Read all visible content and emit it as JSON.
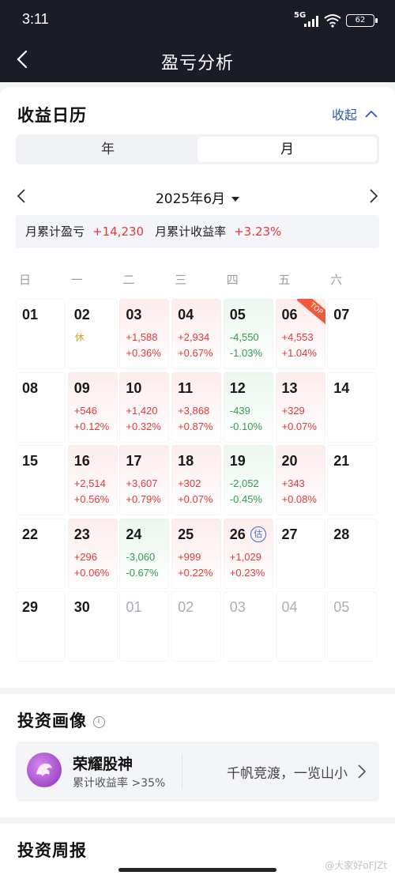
{
  "status": {
    "time": "3:11",
    "network": "5G",
    "battery": "62"
  },
  "nav": {
    "title": "盈亏分析"
  },
  "calendar": {
    "title": "收益日历",
    "collapse_label": "收起",
    "tabs": [
      "年",
      "月"
    ],
    "active_tab": "月",
    "month_label": "2025年6月",
    "summary": {
      "pnl_label": "月累计盈亏",
      "pnl_value": "+14,230",
      "rate_label": "月累计收益率",
      "rate_value": "+3.23%"
    },
    "weekdays": [
      "日",
      "一",
      "二",
      "三",
      "四",
      "五",
      "六"
    ],
    "top_badge": "TOP",
    "estimate_badge": "估",
    "holiday_label": "休",
    "weeks": [
      [
        {
          "day": "01"
        },
        {
          "day": "02",
          "note": "休"
        },
        {
          "day": "03",
          "amt": "+1,588",
          "pct": "+0.36%",
          "trend": "up"
        },
        {
          "day": "04",
          "amt": "+2,934",
          "pct": "+0.67%",
          "trend": "up"
        },
        {
          "day": "05",
          "amt": "-4,550",
          "pct": "-1.03%",
          "trend": "down"
        },
        {
          "day": "06",
          "amt": "+4,553",
          "pct": "+1.04%",
          "trend": "up",
          "top": true
        },
        {
          "day": "07"
        }
      ],
      [
        {
          "day": "08"
        },
        {
          "day": "09",
          "amt": "+546",
          "pct": "+0.12%",
          "trend": "up"
        },
        {
          "day": "10",
          "amt": "+1,420",
          "pct": "+0.32%",
          "trend": "up"
        },
        {
          "day": "11",
          "amt": "+3,868",
          "pct": "+0.87%",
          "trend": "up"
        },
        {
          "day": "12",
          "amt": "-439",
          "pct": "-0.10%",
          "trend": "down"
        },
        {
          "day": "13",
          "amt": "+329",
          "pct": "+0.07%",
          "trend": "up"
        },
        {
          "day": "14"
        }
      ],
      [
        {
          "day": "15"
        },
        {
          "day": "16",
          "amt": "+2,514",
          "pct": "+0.56%",
          "trend": "up"
        },
        {
          "day": "17",
          "amt": "+3,607",
          "pct": "+0.79%",
          "trend": "up"
        },
        {
          "day": "18",
          "amt": "+302",
          "pct": "+0.07%",
          "trend": "up"
        },
        {
          "day": "19",
          "amt": "-2,052",
          "pct": "-0.45%",
          "trend": "down"
        },
        {
          "day": "20",
          "amt": "+343",
          "pct": "+0.08%",
          "trend": "up"
        },
        {
          "day": "21"
        }
      ],
      [
        {
          "day": "22"
        },
        {
          "day": "23",
          "amt": "+296",
          "pct": "+0.06%",
          "trend": "up"
        },
        {
          "day": "24",
          "amt": "-3,060",
          "pct": "-0.67%",
          "trend": "down"
        },
        {
          "day": "25",
          "amt": "+999",
          "pct": "+0.22%",
          "trend": "up"
        },
        {
          "day": "26",
          "amt": "+1,029",
          "pct": "+0.23%",
          "trend": "up",
          "estimate": true
        },
        {
          "day": "27"
        },
        {
          "day": "28"
        }
      ],
      [
        {
          "day": "29"
        },
        {
          "day": "30"
        },
        {
          "day": "01",
          "other": true
        },
        {
          "day": "02",
          "other": true
        },
        {
          "day": "03",
          "other": true
        },
        {
          "day": "04",
          "other": true
        },
        {
          "day": "05",
          "other": true
        }
      ]
    ]
  },
  "portrait": {
    "title": "投资画像",
    "name": "荣耀股神",
    "desc": "累计收益率 >35%",
    "motto": "千帆竞渡，一览山小"
  },
  "weekly": {
    "title": "投资周报"
  },
  "watermark": "@大家好oFJZt",
  "colors": {
    "up": "#e03a3a",
    "down": "#2f9e50",
    "accent": "#2e5aa8",
    "header_bg": "#1b1d25"
  }
}
